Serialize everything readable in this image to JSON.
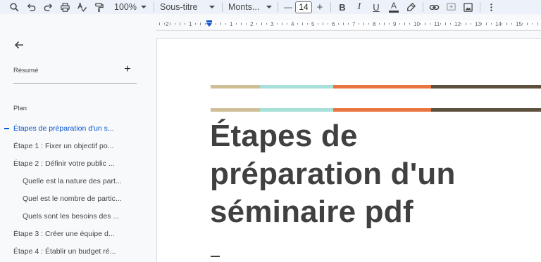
{
  "toolbar": {
    "zoom": "100%",
    "style": "Sous-titre",
    "font": "Monts...",
    "minus": "—",
    "font_size": "14",
    "plus": "+",
    "bold": "B",
    "italic": "I",
    "underline": "U",
    "text_color": "A",
    "text_color_value": "#3c3c3c"
  },
  "ruler": {
    "numbers": [
      "2",
      "1",
      "1",
      "2",
      "3",
      "4",
      "5",
      "6",
      "7",
      "8",
      "9",
      "10",
      "11",
      "12",
      "13",
      "14",
      "15"
    ]
  },
  "sidebar": {
    "summary_label": "Résumé",
    "add": "+",
    "plan_label": "Plan",
    "outline": [
      {
        "label": "Étapes de préparation d'un s...",
        "level": 1,
        "active": true
      },
      {
        "label": "Étape 1 : Fixer un objectif po...",
        "level": 1,
        "active": false
      },
      {
        "label": "Étape 2 : Définir votre public ...",
        "level": 1,
        "active": false
      },
      {
        "label": "Quelle est la nature des part...",
        "level": 2,
        "active": false
      },
      {
        "label": "Quel est le nombre de partic...",
        "level": 2,
        "active": false
      },
      {
        "label": "Quels sont les besoins des ...",
        "level": 2,
        "active": false
      },
      {
        "label": "Étape 3 : Créer une équipe d...",
        "level": 1,
        "active": false
      },
      {
        "label": "Étape 4 : Établir un budget ré...",
        "level": 1,
        "active": false
      }
    ]
  },
  "document": {
    "title_lines": [
      "Étapes de",
      "préparation d'un",
      "séminaire pdf"
    ],
    "accent_colors": [
      "#cfbf97",
      "#a6e0d8",
      "#e8743f",
      "#5c4f3e"
    ]
  }
}
